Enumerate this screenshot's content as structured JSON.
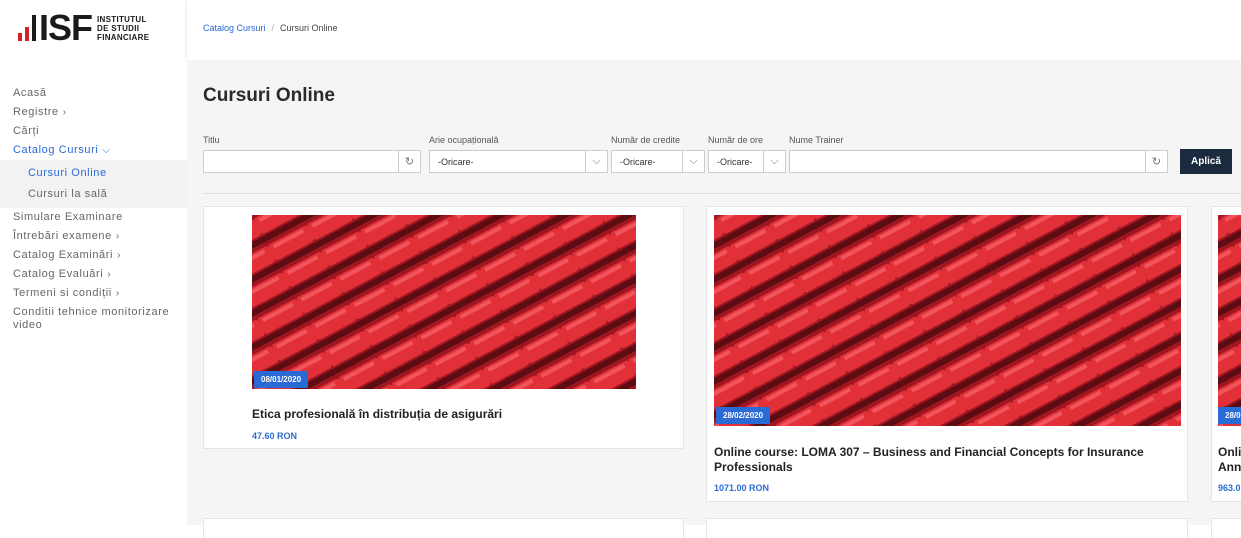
{
  "logo": {
    "mark": "ISF",
    "line1": "INSTITUTUL",
    "line2": "DE STUDII",
    "line3": "FINANCIARE"
  },
  "nav": {
    "items": [
      {
        "label": "Acasă",
        "chevron": false
      },
      {
        "label": "Registre",
        "chevron": true
      },
      {
        "label": "Cărți",
        "chevron": false
      },
      {
        "label": "Catalog Cursuri",
        "chevron": true
      }
    ],
    "sub": [
      {
        "label": "Cursuri Online"
      },
      {
        "label": "Cursuri la sală"
      }
    ],
    "items_after": [
      {
        "label": "Simulare Examinare",
        "chevron": false
      },
      {
        "label": "Întrebări examene",
        "chevron": true
      },
      {
        "label": "Catalog Examinări",
        "chevron": true
      },
      {
        "label": "Catalog Evaluări",
        "chevron": true
      },
      {
        "label": "Termeni si condiții",
        "chevron": true
      },
      {
        "label": "Conditii tehnice monitorizare video",
        "chevron": false
      }
    ],
    "chevron_right": "›",
    "chevron_down": "⌵"
  },
  "breadcrumb": {
    "parent": "Catalog Cursuri",
    "separator": "/",
    "current": "Cursuri Online"
  },
  "page": {
    "title": "Cursuri Online"
  },
  "filters": {
    "title_label": "Titlu",
    "title_value": "",
    "area_label": "Arie ocupațională",
    "area_value": "-Oricare-",
    "credits_label": "Număr de credite",
    "credits_value": "-Oricare-",
    "hours_label": "Număr de ore",
    "hours_value": "-Oricare-",
    "trainer_label": "Nume Trainer",
    "trainer_value": "",
    "apply_label": "Aplică",
    "refresh_glyph": "↻",
    "dropdown_glyph": "⌵"
  },
  "courses": [
    {
      "date": "08/01/2020",
      "title": "Etica profesională în distribuția de asigurări",
      "price": "47.60 RON"
    },
    {
      "date": "28/02/2020",
      "title": "Online course: LOMA 307 – Business and Financial Concepts for Insurance Professionals",
      "price": "1071.00 RON"
    },
    {
      "date": "28/0",
      "title": "Onli Ann",
      "price": "963.0"
    }
  ],
  "colors": {
    "accent": "#2a6ad4",
    "button": "#1b2a3e",
    "seat_red": "#d9252f"
  },
  "icons": [
    "refresh-icon",
    "chevron-down-icon",
    "chevron-right-icon",
    "logo-bars-icon"
  ]
}
